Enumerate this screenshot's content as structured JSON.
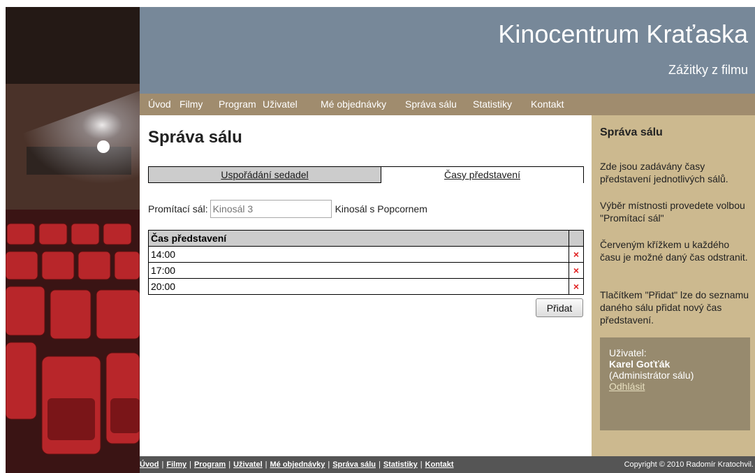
{
  "header": {
    "site_title": "Kinocentrum Kraťaska",
    "site_subtitle": "Zážitky z filmu"
  },
  "nav": {
    "items": [
      {
        "label": "Úvod"
      },
      {
        "label": "Filmy"
      },
      {
        "label": "Program"
      },
      {
        "label": "Uživatel"
      },
      {
        "label": "Mé objednávky"
      },
      {
        "label": "Správa sálu"
      },
      {
        "label": "Statistiky"
      },
      {
        "label": "Kontakt"
      }
    ]
  },
  "main": {
    "title": "Správa sálu",
    "tabs": [
      {
        "label": "Uspořádání sedadel",
        "active": false
      },
      {
        "label": "Časy představení",
        "active": true
      }
    ],
    "hall": {
      "label": "Promítací sál:",
      "placeholder": "Kinosál 3",
      "name": "Kinosál s Popcornem"
    },
    "table": {
      "header": "Čas představení",
      "rows": [
        {
          "time": "14:00",
          "delete_icon": "×"
        },
        {
          "time": "17:00",
          "delete_icon": "×"
        },
        {
          "time": "20:00",
          "delete_icon": "×"
        }
      ]
    },
    "add_button": "Přidat"
  },
  "sidebar": {
    "title": "Správa sálu",
    "paragraphs": [
      "Zde jsou zadávány časy představení jednotlivých sálů.",
      "Výběr místnosti provedete volbou \"Promítací sál\"",
      "Červeným křížkem u každého času je možné daný čas odstranit.",
      "Tlačítkem \"Přidat\" lze do seznamu daného sálu přidat nový čas představení."
    ],
    "user": {
      "label": "Uživatel:",
      "name": "Karel Goťťák",
      "role": "(Administrátor sálu)",
      "logout": "Odhlásit"
    }
  },
  "footer": {
    "links": [
      "Úvod",
      "Filmy",
      "Program",
      "Uživatel",
      "Mé objednávky",
      "Správa sálu",
      "Statistiky",
      "Kontakt"
    ],
    "separator": "|",
    "copyright": "Copyright © 2010 Radomír Kratochvil."
  },
  "colors": {
    "header_bg": "#778899",
    "nav_bg": "#a08c6e",
    "sidebar_bg": "#ccb98f",
    "user_box_bg": "#978a6e",
    "footer_bg": "#555555",
    "delete_icon": "#e02020"
  }
}
